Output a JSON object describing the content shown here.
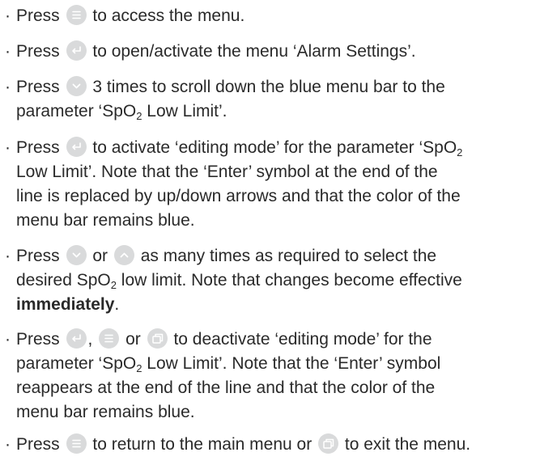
{
  "icons": {
    "menu": "menu-icon",
    "enter": "enter-icon",
    "down": "chevron-down-icon",
    "up": "chevron-up-icon",
    "exit": "exit-window-icon",
    "color": "#d9dadb"
  },
  "steps": [
    {
      "press": "Press",
      "text": "to access the menu."
    },
    {
      "press": "Press",
      "text": "to open/activate the menu ‘Alarm Settings’."
    },
    {
      "press": "Press",
      "text": "3 times to scroll down the blue menu bar to the",
      "line2a": "parameter ‘SpO",
      "sub": "2",
      "line2b": " Low Limit’."
    },
    {
      "press": "Press",
      "text_a": "to activate ‘editing mode’ for the parameter ‘SpO",
      "sub": "2",
      "line2": "Low Limit’. Note that the ‘Enter’ symbol at the end of the",
      "line3": "line is replaced by up/down arrows and that the color of the",
      "line4": "menu bar remains blue."
    },
    {
      "press": "Press",
      "or": "or",
      "text": "as many times as required to select the",
      "line2a": "desired SpO",
      "sub": "2",
      "line2b": " low limit. Note that changes become effective",
      "bold": "immediately",
      "end": "."
    },
    {
      "press": "Press",
      "comma": ",",
      "or": "or",
      "text": "to deactivate ‘editing mode’ for the",
      "line2a": "parameter ‘SpO",
      "sub": "2",
      "line2b": " Low Limit’. Note that the ‘Enter’ symbol",
      "line3": "reappears at the end of the line and that the color of the",
      "line4": "menu bar remains blue."
    },
    {
      "press": "Press",
      "text": "to return to the main menu or",
      "end": "to exit the menu."
    }
  ]
}
